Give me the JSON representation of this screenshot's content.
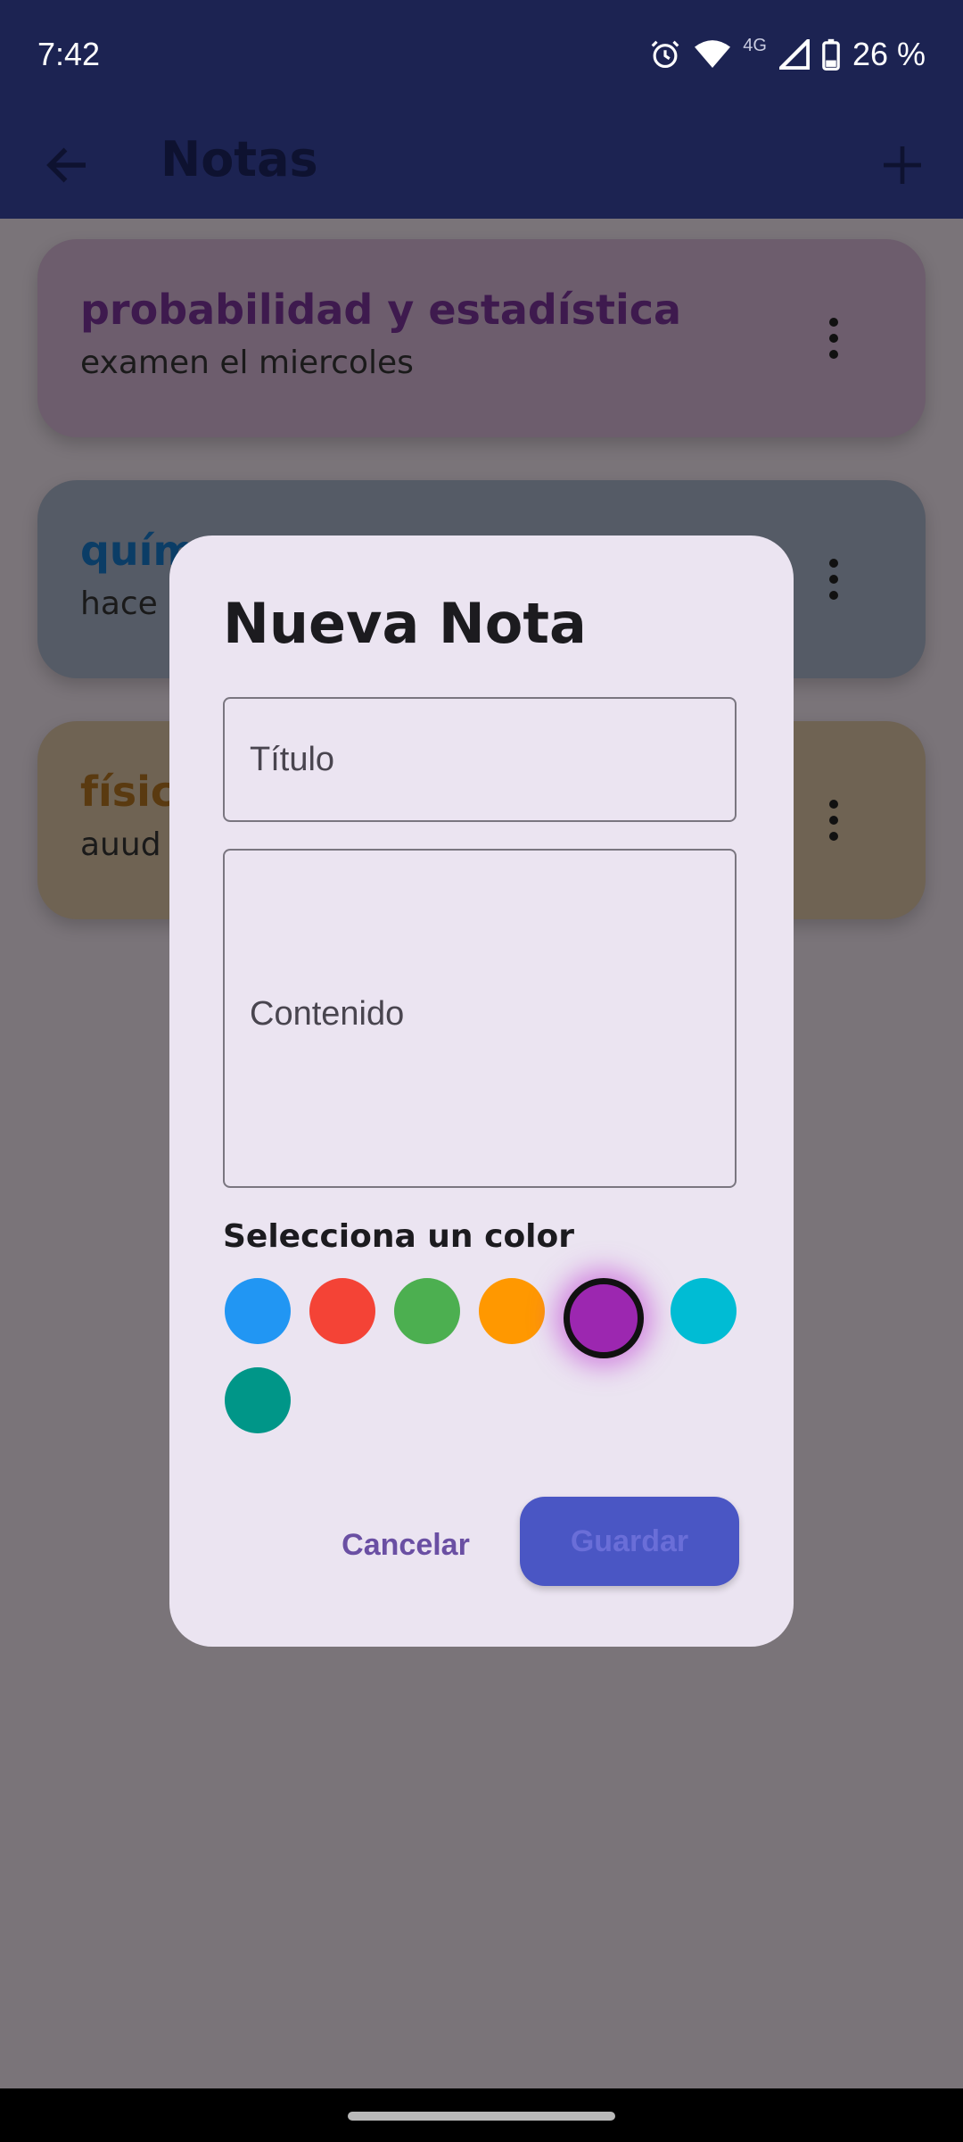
{
  "status_bar": {
    "time": "7:42",
    "network": "4G",
    "battery": "26 %",
    "icons": [
      "alarm-icon",
      "wifi-icon",
      "signal-icon",
      "battery-icon"
    ]
  },
  "app_bar": {
    "title": "Notas",
    "icons": [
      "back-arrow-icon",
      "add-icon"
    ]
  },
  "notes": [
    {
      "title": "probabilidad y estadística",
      "content": "examen el miercoles",
      "color": "#8e4aa0",
      "title_color": "#4a1f5c"
    },
    {
      "title": "quím",
      "content": "hace",
      "color": "#5e7ea0",
      "title_color": "#0b4f82"
    },
    {
      "title": "físic",
      "content": "auud",
      "color": "#a68b5e",
      "title_color": "#6b4210"
    }
  ],
  "dialog": {
    "title": "Nueva Nota",
    "title_field": {
      "placeholder": "Título",
      "value": ""
    },
    "content_field": {
      "placeholder": "Contenido",
      "value": ""
    },
    "color_label": "Selecciona un color",
    "colors": [
      "#2196f3",
      "#f44336",
      "#4caf50",
      "#ff9800",
      "#9c27b0",
      "#00bcd4",
      "#009688"
    ],
    "selected_color": "#9c27b0",
    "cancel_label": "Cancelar",
    "save_label": "Guardar"
  },
  "colors": {
    "app_bar": "#1c2352",
    "scrim": "#7a7479",
    "dialog_bg": "#ebe4f1",
    "primary": "#4a56c4"
  }
}
